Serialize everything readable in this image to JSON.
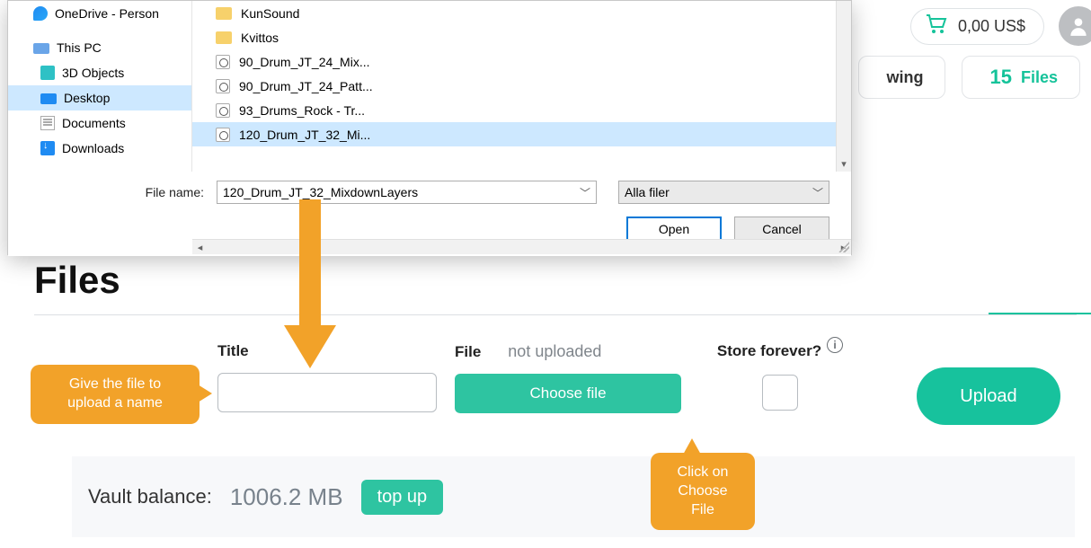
{
  "dialog": {
    "nav": {
      "onedrive": "OneDrive - Person",
      "thispc": "This PC",
      "threeD": "3D Objects",
      "desktop": "Desktop",
      "documents": "Documents",
      "downloads": "Downloads"
    },
    "files": {
      "f0": "KunSound",
      "f1": "Kvittos",
      "f2": "90_Drum_JT_24_Mix...",
      "f3": "90_Drum_JT_24_Patt...",
      "f4": "93_Drums_Rock - Tr...",
      "f5": "120_Drum_JT_32_Mi..."
    },
    "filename_label": "File name:",
    "filename_value": "120_Drum_JT_32_MixdownLayers",
    "filter_value": "Alla filer",
    "open_btn": "Open",
    "cancel_btn": "Cancel"
  },
  "topbar": {
    "cart_total": "0,00 US$"
  },
  "stats": {
    "following_label": "wing",
    "files_count": "15",
    "files_label": "Files"
  },
  "main": {
    "heading": "Files",
    "title_label": "Title",
    "file_label": "File",
    "not_uploaded": "not uploaded",
    "choose_file": "Choose file",
    "store_label": "Store forever?",
    "upload_btn": "Upload"
  },
  "balance": {
    "label": "Vault balance:",
    "value": "1006.2 MB",
    "topup": "top up"
  },
  "callouts": {
    "left_l1": "Give the file to",
    "left_l2": "upload a name",
    "right_l1": "Click on",
    "right_l2": "Choose File"
  }
}
